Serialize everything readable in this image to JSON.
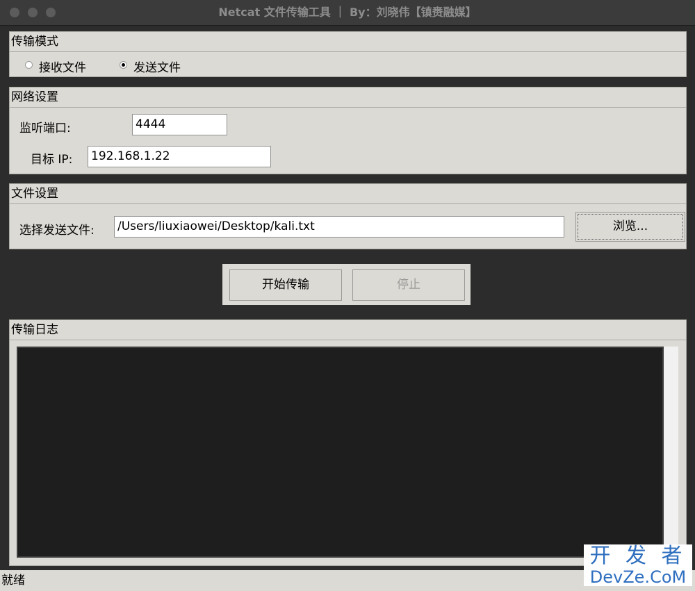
{
  "window": {
    "title": "Netcat 文件传输工具 ｜ By：刘晓伟【镇赉融媒】"
  },
  "transfer_mode": {
    "title": "传输模式",
    "options": [
      {
        "label": "接收文件",
        "selected": false
      },
      {
        "label": "发送文件",
        "selected": true
      }
    ]
  },
  "network": {
    "title": "网络设置",
    "port_label": "监听端口:",
    "port_value": "4444",
    "target_ip_label": "目标 IP:",
    "target_ip_value": "192.168.1.22"
  },
  "file": {
    "title": "文件设置",
    "select_label": "选择发送文件:",
    "path_value": "/Users/liuxiaowei/Desktop/kali.txt",
    "browse_label": "浏览..."
  },
  "actions": {
    "start_label": "开始传输",
    "stop_label": "停止",
    "stop_disabled": true
  },
  "log": {
    "title": "传输日志",
    "content": ""
  },
  "status_bar": {
    "text": "就绪"
  },
  "watermark": {
    "line1": "开 发 者",
    "line2": "DevZe.CoM"
  },
  "colors": {
    "panel_bg": "#dcdad5",
    "window_bg": "#2c2c2c",
    "log_bg": "#1e1e1e",
    "watermark": "#2f6fbf"
  }
}
